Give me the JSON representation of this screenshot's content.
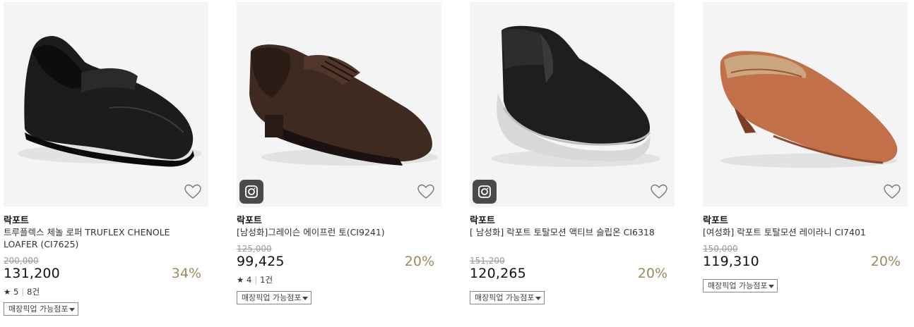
{
  "products": [
    {
      "brand": "락포트",
      "title": "트루플렉스 체놀 로퍼 TRUFLEX CHENOLE LOAFER (CI7625)",
      "original_price": "200,000",
      "price": "131,200",
      "discount": "34%",
      "rating_star": "★",
      "rating_score": "5",
      "rating_sep": "|",
      "review_count": "8건",
      "pickup_label": "매장픽업 가능점포",
      "wishlist_icon": "heart-icon",
      "has_instagram": false
    },
    {
      "brand": "락포트",
      "title": "[남성화]그레이슨 에이프런 토(CI9241)",
      "original_price": "125,000",
      "price": "99,425",
      "discount": "20%",
      "rating_star": "★",
      "rating_score": "4",
      "rating_sep": "|",
      "review_count": "1건",
      "pickup_label": "매장픽업 가능점포",
      "wishlist_icon": "heart-icon",
      "has_instagram": true
    },
    {
      "brand": "락포트",
      "title": "[ 남성화] 락포트 토탈모션 액티브 슬립온 CI6318",
      "original_price": "151,200",
      "price": "120,265",
      "discount": "20%",
      "pickup_label": "매장픽업 가능점포",
      "wishlist_icon": "heart-icon",
      "has_instagram": true
    },
    {
      "brand": "락포트",
      "title": "[여성화] 락포트 토탈모션 레이라니 CI7401",
      "original_price": "150,000",
      "price": "119,310",
      "discount": "20%",
      "pickup_label": "매장픽업 가능점포",
      "wishlist_icon": "heart-icon",
      "has_instagram": false
    }
  ],
  "colors": {
    "discount": "#9b8a5e",
    "image_bg": "#f4f4f4"
  }
}
